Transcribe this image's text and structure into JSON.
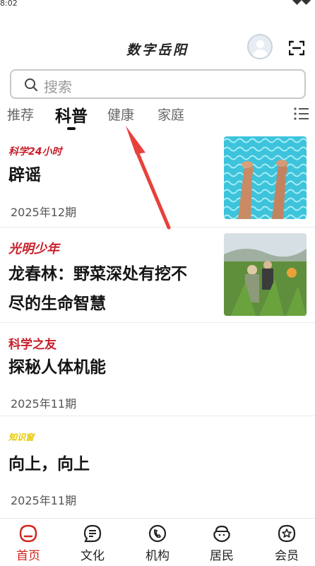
{
  "status": {
    "time": "8:02"
  },
  "header": {
    "title": "数字岳阳"
  },
  "search": {
    "placeholder": "搜索"
  },
  "tabs": [
    {
      "label": "推荐"
    },
    {
      "label": "科普"
    },
    {
      "label": "健康"
    },
    {
      "label": "家庭"
    }
  ],
  "feed": [
    {
      "brand": "科学24小时",
      "headline": "辟谣",
      "date": "2025年12期"
    },
    {
      "brand": "光明少年",
      "headline_line1": "龙春林：野菜深处有挖不",
      "headline_line2": "尽的生命智慧"
    },
    {
      "brand": "科学之友",
      "headline": "探秘人体机能",
      "date": "2025年11期"
    },
    {
      "brand": "知识窗",
      "headline": "向上，向上",
      "date": "2025年11期"
    }
  ],
  "bottom_nav": [
    {
      "label": "首页",
      "icon": "home-icon"
    },
    {
      "label": "文化",
      "icon": "culture-icon"
    },
    {
      "label": "机构",
      "icon": "institution-icon"
    },
    {
      "label": "居民",
      "icon": "residents-icon"
    },
    {
      "label": "会员",
      "icon": "member-icon"
    }
  ],
  "colors": {
    "accent": "#d2231c",
    "brand_red": "#c8202b",
    "brand_yellow": "#e8c800"
  }
}
